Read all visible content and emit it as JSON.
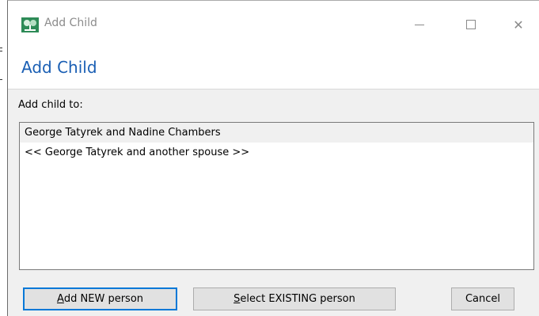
{
  "window": {
    "title": "Add Child",
    "minimize_glyph": "",
    "maximize_glyph": "",
    "close_glyph": "✕"
  },
  "header": {
    "title": "Add Child"
  },
  "main": {
    "section_label": "Add child to:",
    "list_items": [
      {
        "label": "George Tatyrek and Nadine Chambers",
        "selected": true
      },
      {
        "label": "<< George Tatyrek and another spouse >>",
        "selected": false
      }
    ]
  },
  "buttons": {
    "add_new": {
      "mnemonic": "A",
      "rest": "dd NEW person"
    },
    "select_existing": {
      "mnemonic": "S",
      "rest": "elect EXISTING person"
    },
    "cancel": "Cancel"
  },
  "colors": {
    "header_title": "#1a5fb4",
    "default_button_border": "#0078d7",
    "selected_row": "#f0f0f0"
  },
  "icons": {
    "app": "family-tree-icon",
    "minimize": "minimize-icon",
    "maximize": "maximize-icon",
    "close": "close-icon"
  }
}
